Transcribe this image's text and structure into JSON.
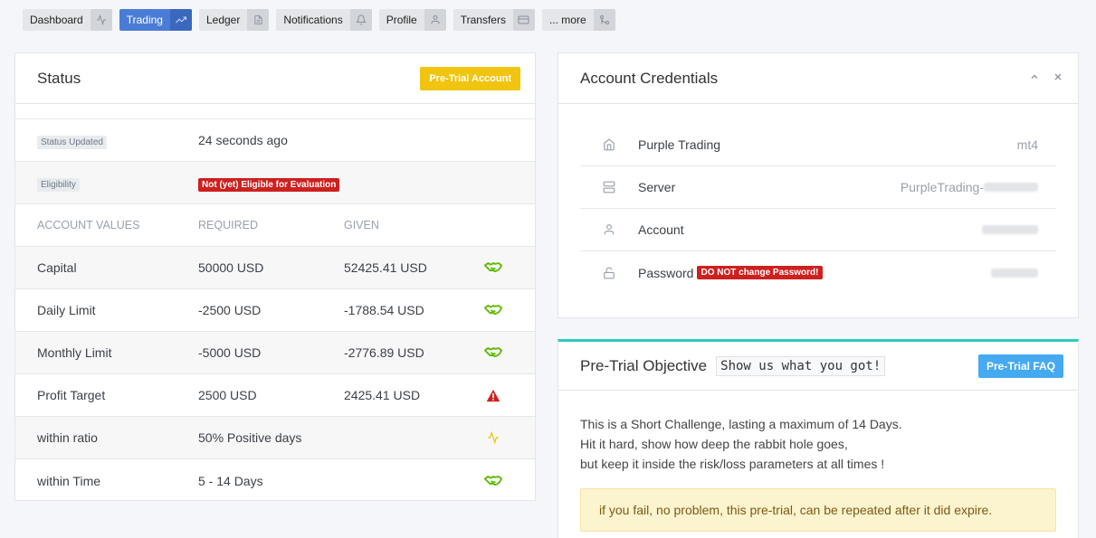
{
  "nav": [
    {
      "label": "Dashboard",
      "icon": "activity-icon",
      "active": false
    },
    {
      "label": "Trading",
      "icon": "trending-up-icon",
      "active": true
    },
    {
      "label": "Ledger",
      "icon": "file-icon",
      "active": false
    },
    {
      "label": "Notifications",
      "icon": "bell-icon",
      "active": false
    },
    {
      "label": "Profile",
      "icon": "user-icon",
      "active": false
    },
    {
      "label": "Transfers",
      "icon": "credit-card-icon",
      "active": false
    },
    {
      "label": "... more",
      "icon": "git-merge-icon",
      "active": false
    }
  ],
  "status": {
    "title": "Status",
    "badge": "Pre-Trial Account",
    "updated_label": "Status Updated",
    "updated_value": "24 seconds ago",
    "eligibility_label": "Eligibility",
    "eligibility_value": "Not (yet) Eligible for Evaluation",
    "columns": [
      "ACCOUNT VALUES",
      "REQUIRED",
      "GIVEN"
    ],
    "rows": [
      {
        "name": "Capital",
        "required": "50000 USD",
        "given": "52425.41 USD",
        "icon": "handshake-icon"
      },
      {
        "name": "Daily Limit",
        "required": "-2500 USD",
        "given": "-1788.54 USD",
        "icon": "handshake-icon"
      },
      {
        "name": "Monthly Limit",
        "required": "-5000 USD",
        "given": "-2776.89 USD",
        "icon": "handshake-icon"
      },
      {
        "name": "Profit Target",
        "required": "2500 USD",
        "given": "2425.41 USD",
        "icon": "warning-icon"
      },
      {
        "name": "within ratio",
        "required": "50% Positive days",
        "given": "",
        "icon": "activity-icon"
      },
      {
        "name": "within Time",
        "required": "5 - 14 Days",
        "given": "",
        "icon": "handshake-icon"
      }
    ]
  },
  "credentials": {
    "title": "Account Credentials",
    "rows": [
      {
        "label": "Purple Trading",
        "value": "mt4",
        "icon": "home-icon"
      },
      {
        "label": "Server",
        "value": "PurpleTrading-",
        "icon": "server-icon"
      },
      {
        "label": "Account",
        "value": "",
        "icon": "user-icon"
      },
      {
        "label": "Password",
        "value": "",
        "icon": "lock-icon",
        "tag": "DO NOT change Password!"
      }
    ]
  },
  "objective": {
    "title": "Pre-Trial Objective",
    "code": "Show us what you got!",
    "faq_button": "Pre-Trial FAQ",
    "lines": [
      "This is a Short Challenge, lasting a maximum of 14 Days.",
      "Hit it hard, show how deep the rabbit hole goes,",
      "but keep it inside the risk/loss parameters at all times !"
    ],
    "alert": "if you fail, no problem, this pre-trial, can be repeated after it did expire."
  },
  "colors": {
    "active_nav": "#4a7cd6",
    "ok_green": "#5eba00",
    "warning_red": "#cd201f",
    "yellow": "#f1c40f",
    "blue": "#45aaf2",
    "teal": "#2bcbba"
  }
}
